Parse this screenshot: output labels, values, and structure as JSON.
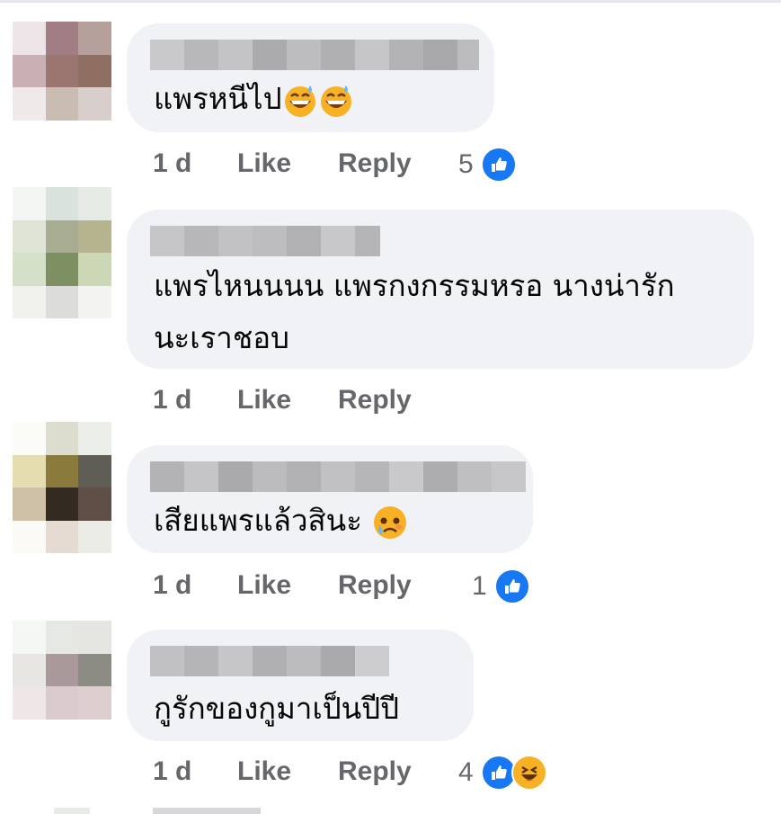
{
  "comments": [
    {
      "text": "แพรหนีไป",
      "emojis": [
        "grinning-sweat-icon",
        "grinning-sweat-icon"
      ],
      "time": "1 d",
      "like": "Like",
      "reply": "Reply",
      "reaction_count": "5",
      "reactions": [
        "like-icon"
      ]
    },
    {
      "text_line1": "แพรไหนนนน แพรกงกรรมหรอ นางน่ารัก",
      "text_line2": "นะเราชอบ",
      "time": "1 d",
      "like": "Like",
      "reply": "Reply"
    },
    {
      "text": "เสียแพรแล้วสินะ",
      "emojis": [
        "face-holding-back-tears-icon"
      ],
      "time": "1 d",
      "like": "Like",
      "reply": "Reply",
      "reaction_count": "1",
      "reactions": [
        "like-icon"
      ]
    },
    {
      "text": "กูรักของกูมาเป็นปีปี",
      "time": "1 d",
      "like": "Like",
      "reply": "Reply",
      "reaction_count": "4",
      "reactions": [
        "like-icon",
        "haha-icon"
      ]
    }
  ],
  "colors": {
    "bubble": "#f0f2f5",
    "meta_text": "#65676b",
    "like_blue": "#1877f2",
    "haha_yellow": "#f7b125"
  }
}
